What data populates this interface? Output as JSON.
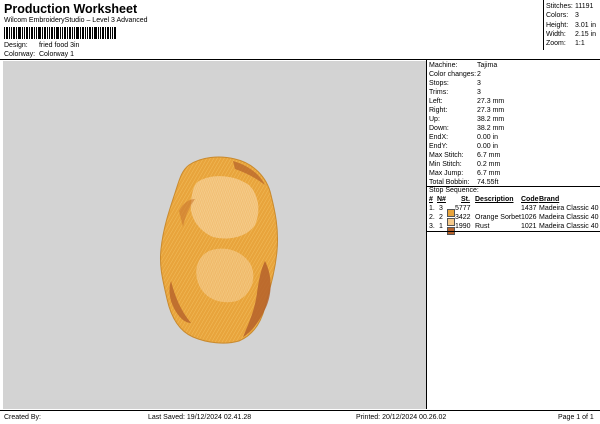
{
  "header": {
    "title": "Production Worksheet",
    "subtitle": "Wilcom EmbroideryStudio – Level 3 Advanced",
    "design_label": "Design:",
    "design_value": "fried food 3in",
    "colorway_label": "Colorway:",
    "colorway_value": "Colorway 1"
  },
  "stats": [
    {
      "label": "Stitches:",
      "value": "11191"
    },
    {
      "label": "Colors:",
      "value": "3"
    },
    {
      "label": "Height:",
      "value": "3.01 in"
    },
    {
      "label": "Width:",
      "value": "2.15 in"
    },
    {
      "label": "Zoom:",
      "value": "1:1"
    }
  ],
  "machine_info": [
    {
      "label": "Machine:",
      "value": "Tajima"
    },
    {
      "label": "Color changes:",
      "value": "2"
    },
    {
      "label": "Stops:",
      "value": "3"
    },
    {
      "label": "Trims:",
      "value": "3"
    },
    {
      "label": "Left:",
      "value": "27.3 mm"
    },
    {
      "label": "Right:",
      "value": "27.3 mm"
    },
    {
      "label": "Up:",
      "value": "38.2 mm"
    },
    {
      "label": "Down:",
      "value": "38.2 mm"
    },
    {
      "label": "EndX:",
      "value": "0.00 in"
    },
    {
      "label": "EndY:",
      "value": "0.00 in"
    },
    {
      "label": "Max Stitch:",
      "value": "6.7 mm"
    },
    {
      "label": "Min Stitch:",
      "value": "0.2 mm"
    },
    {
      "label": "Max Jump:",
      "value": "6.7 mm"
    },
    {
      "label": "Total Bobbin:",
      "value": "74.55ft"
    }
  ],
  "stop_sequence": {
    "title": "Stop Sequence:",
    "columns": [
      "#",
      "N#",
      "St.",
      "Description",
      "Code",
      "Brand"
    ],
    "rows": [
      {
        "num": "1.",
        "n": "3",
        "st": "5777",
        "description": "",
        "code": "1437",
        "brand": "Madeira Classic 40",
        "color": "#e8a43c"
      },
      {
        "num": "2.",
        "n": "2",
        "st": "3422",
        "description": "Orange Sorbet",
        "code": "1026",
        "brand": "Madeira Classic 40",
        "color": "#f5c98a"
      },
      {
        "num": "3.",
        "n": "1",
        "st": "1990",
        "description": "Rust",
        "code": "1021",
        "brand": "Madeira Classic 40",
        "color": "#b5612a"
      }
    ]
  },
  "footer": {
    "created_by": "Created By:",
    "last_saved": "Last Saved: 19/12/2024 02.41.28",
    "printed": "Printed: 20/12/2024 00.26.02",
    "page": "Page 1 of 1"
  },
  "colors": {
    "canvas_bg": "#d3d3d3",
    "design_main": "#e8a43c",
    "design_light": "#f5c98a",
    "design_rust": "#b5612a"
  }
}
